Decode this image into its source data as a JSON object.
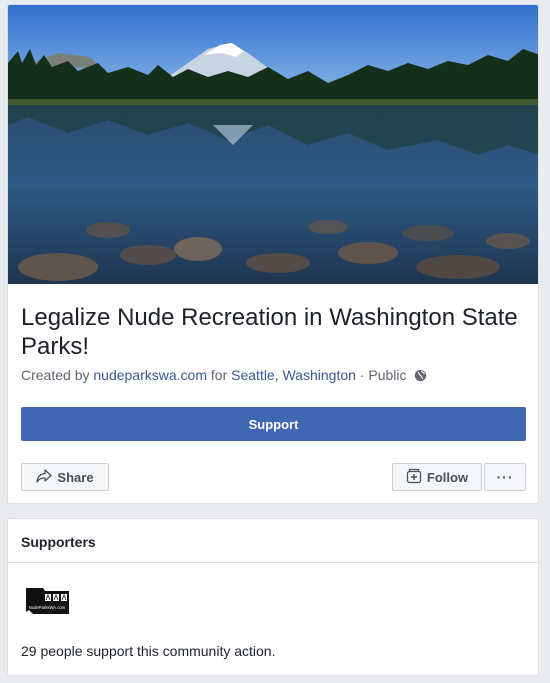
{
  "page": {
    "title": "Legalize Nude Recreation in Washington State Parks!",
    "created_by_prefix": "Created by",
    "creator": "nudeparkswa.com",
    "for_word": "for",
    "location": "Seattle, Washington",
    "separator": "·",
    "privacy": "Public"
  },
  "actions": {
    "support_label": "Support",
    "share_label": "Share",
    "follow_label": "Follow",
    "more_label": "···"
  },
  "supporters": {
    "header": "Supporters",
    "logo_url_text": "NudeParksWA.com",
    "count_text": "29 people support this community action."
  },
  "colors": {
    "primary": "#4267b2",
    "link": "#385898",
    "sky": "#3d7fd3",
    "water": "#2a4f7e"
  }
}
